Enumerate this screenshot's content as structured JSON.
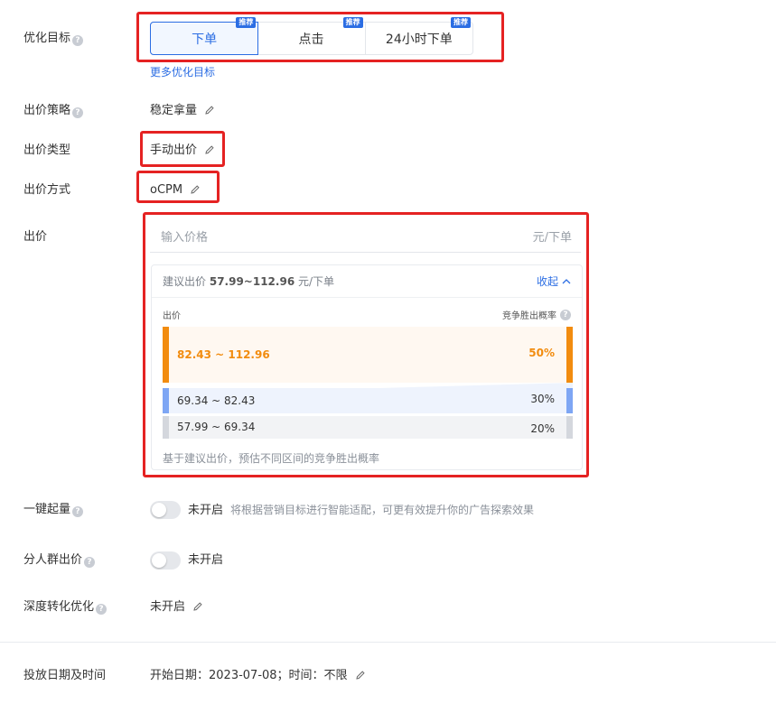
{
  "optimization": {
    "label": "优化目标",
    "options": [
      {
        "label": "下单",
        "badge": "推荐"
      },
      {
        "label": "点击",
        "badge": "推荐"
      },
      {
        "label": "24小时下单",
        "badge": "推荐"
      }
    ],
    "more_link": "更多优化目标"
  },
  "bid_strategy": {
    "label": "出价策略",
    "value": "稳定拿量"
  },
  "bid_type": {
    "label": "出价类型",
    "value": "手动出价"
  },
  "bid_method": {
    "label": "出价方式",
    "value": "oCPM"
  },
  "bid": {
    "label": "出价",
    "input_placeholder": "输入价格",
    "unit": "元/下单",
    "suggest_prefix": "建议出价",
    "suggest_range": "57.99~112.96",
    "suggest_unit": "元/下单",
    "collapse_label": "收起",
    "col_price": "出价",
    "col_win_rate": "竞争胜出概率",
    "rows": [
      {
        "range": "82.43 ~ 112.96",
        "pct": "50%",
        "color": "#f28c0f"
      },
      {
        "range": "69.34 ~ 82.43",
        "pct": "30%",
        "color": "#7ea6f4"
      },
      {
        "range": "57.99 ~ 69.34",
        "pct": "20%",
        "color": "#d4d7dd"
      }
    ],
    "footnote": "基于建议出价，预估不同区间的竞争胜出概率"
  },
  "one_click_boost": {
    "label": "一键起量",
    "state": "未开启",
    "description": "将根据营销目标进行智能适配，可更有效提升你的广告探索效果"
  },
  "audience_bid": {
    "label": "分人群出价",
    "state": "未开启"
  },
  "deep_conversion": {
    "label": "深度转化优化",
    "value": "未开启"
  },
  "schedule": {
    "label": "投放日期及时间",
    "value": "开始日期：2023-07-08；时间：不限"
  },
  "colors": {
    "accent": "#2b6de3",
    "highlight": "#e52222",
    "orange": "#f28c0f"
  }
}
